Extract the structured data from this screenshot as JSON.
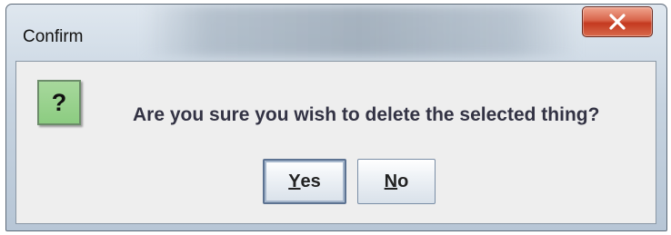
{
  "dialog": {
    "title": "Confirm",
    "message": "Are you sure you wish to delete the selected thing?",
    "icon": "question-icon",
    "icon_glyph": "?"
  },
  "buttons": {
    "yes": {
      "mnemonic": "Y",
      "rest": "es"
    },
    "no": {
      "mnemonic": "N",
      "rest": "o"
    }
  },
  "colors": {
    "icon_bg": "#8ccc81",
    "close_button": "#c4391f"
  }
}
